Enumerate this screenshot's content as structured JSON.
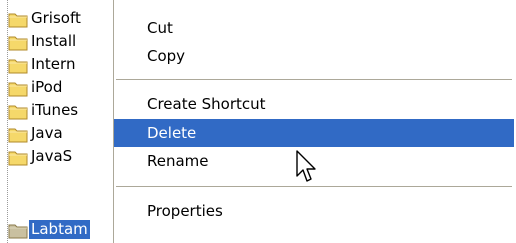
{
  "tree": {
    "items": [
      {
        "label": "Grisoft",
        "selected": false
      },
      {
        "label": "Install",
        "selected": false
      },
      {
        "label": "Intern",
        "selected": false
      },
      {
        "label": "iPod",
        "selected": false
      },
      {
        "label": "iTunes",
        "selected": false
      },
      {
        "label": "Java",
        "selected": false
      },
      {
        "label": "JavaS",
        "selected": false
      },
      {
        "label": "Labtam",
        "selected": true
      }
    ],
    "icon": "folder-icon"
  },
  "menu": {
    "cut": "Cut",
    "copy": "Copy",
    "create_shortcut": "Create Shortcut",
    "delete": "Delete",
    "rename": "Rename",
    "properties": "Properties",
    "highlighted_item": "Delete"
  },
  "colors": {
    "selection": "#316ac5",
    "separator": "#aca899",
    "folder": "#f5d86a"
  },
  "cursor": {
    "icon": "arrow-cursor-icon"
  }
}
